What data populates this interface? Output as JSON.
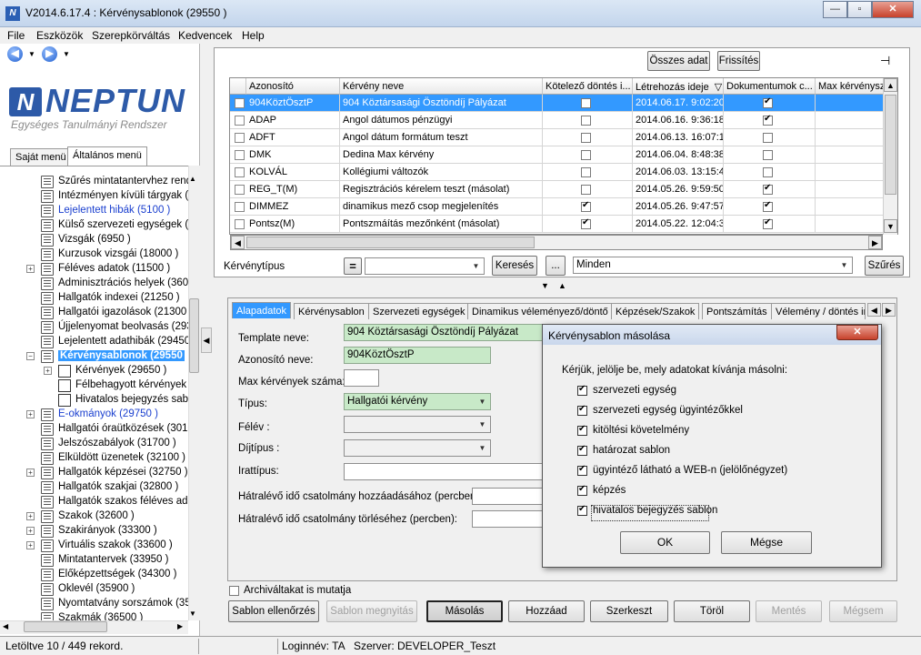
{
  "window": {
    "title": "V2014.6.17.4 : Kérvénysablonok (29550 )",
    "icon_letter": "N"
  },
  "menu": [
    "File",
    "Eszközök",
    "Szerepkörváltás",
    "Kedvencek",
    "Help"
  ],
  "logo": {
    "name": "NEPTUN",
    "subtitle": "Egységes Tanulmányi Rendszer"
  },
  "left_tabs": [
    "Saját menü",
    "Általános menü"
  ],
  "tree": [
    {
      "label": "Szűrés mintatantervhez rende",
      "level": 0,
      "expander": "",
      "icon": "folder",
      "style": ""
    },
    {
      "label": "Intézményen kívüli tárgyak (4",
      "level": 0,
      "expander": "",
      "icon": "folder",
      "style": ""
    },
    {
      "label": "Lejelentett hibák (5100 )",
      "level": 0,
      "expander": "",
      "icon": "folder",
      "style": "blue"
    },
    {
      "label": "Külső szervezeti egységek (6",
      "level": 0,
      "expander": "",
      "icon": "folder",
      "style": ""
    },
    {
      "label": "Vizsgák (6950 )",
      "level": 0,
      "expander": "",
      "icon": "folder",
      "style": ""
    },
    {
      "label": "Kurzusok vizsgái (18000 )",
      "level": 0,
      "expander": "",
      "icon": "folder",
      "style": ""
    },
    {
      "label": "Féléves adatok (11500 )",
      "level": 0,
      "expander": "+",
      "icon": "folder",
      "style": ""
    },
    {
      "label": "Adminisztrációs helyek (3600",
      "level": 0,
      "expander": "",
      "icon": "folder",
      "style": ""
    },
    {
      "label": "Hallgatók indexei (21250 )",
      "level": 0,
      "expander": "",
      "icon": "folder",
      "style": ""
    },
    {
      "label": "Hallgatói igazolások (21300 )",
      "level": 0,
      "expander": "",
      "icon": "folder",
      "style": ""
    },
    {
      "label": "Újjelenyomat beolvasás (29300",
      "level": 0,
      "expander": "",
      "icon": "folder",
      "style": ""
    },
    {
      "label": "Lejelentett adathibák (29450",
      "level": 0,
      "expander": "",
      "icon": "folder",
      "style": ""
    },
    {
      "label": "Kérvénysablonok (29550",
      "level": 0,
      "expander": "−",
      "icon": "folder",
      "style": "selected"
    },
    {
      "label": "Kérvények (29650 )",
      "level": 1,
      "expander": "+",
      "icon": "doc",
      "style": ""
    },
    {
      "label": "Félbehagyott kérvények (",
      "level": 1,
      "expander": "",
      "icon": "doc",
      "style": ""
    },
    {
      "label": "Hivatalos bejegyzés sablo",
      "level": 1,
      "expander": "",
      "icon": "doc",
      "style": ""
    },
    {
      "label": "E-okmányok (29750 )",
      "level": 0,
      "expander": "+",
      "icon": "folder",
      "style": "blue"
    },
    {
      "label": "Hallgatói óraütközések (3010",
      "level": 0,
      "expander": "",
      "icon": "folder",
      "style": ""
    },
    {
      "label": "Jelszószabályok (31700 )",
      "level": 0,
      "expander": "",
      "icon": "folder",
      "style": ""
    },
    {
      "label": "Elküldött üzenetek (32100 )",
      "level": 0,
      "expander": "",
      "icon": "folder",
      "style": ""
    },
    {
      "label": "Hallgatók képzései (32750 )",
      "level": 0,
      "expander": "+",
      "icon": "folder",
      "style": ""
    },
    {
      "label": "Hallgatók szakjai (32800 )",
      "level": 0,
      "expander": "",
      "icon": "folder",
      "style": ""
    },
    {
      "label": "Hallgatók szakos féléves ada",
      "level": 0,
      "expander": "",
      "icon": "folder",
      "style": ""
    },
    {
      "label": "Szakok (32600 )",
      "level": 0,
      "expander": "+",
      "icon": "folder",
      "style": ""
    },
    {
      "label": "Szakirányok (33300 )",
      "level": 0,
      "expander": "+",
      "icon": "folder",
      "style": ""
    },
    {
      "label": "Virtuális szakok (33600 )",
      "level": 0,
      "expander": "+",
      "icon": "folder",
      "style": ""
    },
    {
      "label": "Mintatantervek (33950 )",
      "level": 0,
      "expander": "",
      "icon": "folder",
      "style": ""
    },
    {
      "label": "Előképzettségek (34300 )",
      "level": 0,
      "expander": "",
      "icon": "folder",
      "style": ""
    },
    {
      "label": "Oklevél (35900 )",
      "level": 0,
      "expander": "",
      "icon": "folder",
      "style": ""
    },
    {
      "label": "Nyomtatvány sorszámok (359",
      "level": 0,
      "expander": "",
      "icon": "folder",
      "style": ""
    },
    {
      "label": "Szakmák (36500 )",
      "level": 0,
      "expander": "",
      "icon": "folder",
      "style": ""
    }
  ],
  "top_buttons": {
    "osszes_adat": "Összes adat",
    "frissites": "Frissítés"
  },
  "grid": {
    "columns": [
      "Azonosító",
      "Kérvény neve",
      "Kötelező döntés i...",
      "Létrehozás ideje",
      "Dokumentumok c...",
      "Max kérvénysz"
    ],
    "sort_indicator": "▽",
    "rows": [
      {
        "id": "904KöztÖsztP",
        "name": "904 Köztársasági Ösztöndíj Pályázat",
        "kotelezo": false,
        "letrehozas": "2014.06.17. 9:02:20",
        "dokumentumok": true,
        "selected": true
      },
      {
        "id": "ADAP",
        "name": "Angol dátumos pénzügyi",
        "kotelezo": false,
        "letrehozas": "2014.06.16. 9:36:18",
        "dokumentumok": true,
        "selected": false
      },
      {
        "id": "ADFT",
        "name": "Angol dátum formátum teszt",
        "kotelezo": false,
        "letrehozas": "2014.06.13. 16:07:1",
        "dokumentumok": false,
        "selected": false
      },
      {
        "id": "DMK",
        "name": "Dedina Max kérvény",
        "kotelezo": false,
        "letrehozas": "2014.06.04. 8:48:38",
        "dokumentumok": false,
        "selected": false
      },
      {
        "id": "KOLVÁL",
        "name": "Kollégiumi változók",
        "kotelezo": false,
        "letrehozas": "2014.06.03. 13:15:4",
        "dokumentumok": false,
        "selected": false
      },
      {
        "id": "REG_T(M)",
        "name": "Regisztrációs kérelem teszt (másolat)",
        "kotelezo": false,
        "letrehozas": "2014.05.26. 9:59:50",
        "dokumentumok": true,
        "selected": false
      },
      {
        "id": "DIMMEZ",
        "name": "dinamikus mező csop megjelenítés",
        "kotelezo": true,
        "letrehozas": "2014.05.26. 9:47:57",
        "dokumentumok": true,
        "selected": false
      },
      {
        "id": "Pontsz(M)",
        "name": "Pontszmáítás mezőnként (másolat)",
        "kotelezo": true,
        "letrehozas": "2014.05.22. 12:04:3",
        "dokumentumok": true,
        "selected": false
      }
    ]
  },
  "filter": {
    "label": "Kérvénytípus",
    "eq_symbol": "=",
    "search_button": "Keresés",
    "dots_button": "...",
    "value": "Minden",
    "filter_button": "Szűrés"
  },
  "detail_tabs": [
    "Alapadatok",
    "Kérvénysablon",
    "Szervezeti egységek",
    "Dinamikus véleményező/döntő",
    "Képzések/Szakok",
    "Pontszámítás",
    "Vélemény / döntés in"
  ],
  "form": {
    "template_nev": {
      "label": "Template neve:",
      "value": "904 Köztársasági Ösztöndíj Pályázat"
    },
    "azonosito": {
      "label": "Azonosító neve:",
      "value": "904KöztÖsztP"
    },
    "max_kervenyek": {
      "label": "Max kérvények száma:",
      "value": ""
    },
    "tipus": {
      "label": "Típus:",
      "value": "Hallgatói kérvény"
    },
    "felev": {
      "label": "Félév :",
      "value": ""
    },
    "dijtipus": {
      "label": "Díjtípus :",
      "value": ""
    },
    "irattipus": {
      "label": "Irattípus:",
      "value": ""
    },
    "hatralevo_hozzaadas": {
      "label": "Hátralévő idő csatolmány hozzáadásához (percben):",
      "value": ""
    },
    "hatralevo_torles": {
      "label": "Hátralévő idő csatolmány törléséhez (percben):",
      "value": ""
    },
    "archival": {
      "label": "Archiváltakat is mutatja",
      "checked": false
    }
  },
  "bottom_buttons": {
    "sablon_ellenorzes": "Sablon ellenőrzés",
    "sablon_megnyitas": "Sablon megnyitás",
    "masolas": "Másolás",
    "hozzaad": "Hozzáad",
    "szerkeszt": "Szerkeszt",
    "torol": "Töröl",
    "mentes": "Mentés",
    "megsem": "Mégsem"
  },
  "modal": {
    "title": "Kérvénysablon másolása",
    "close": "✕",
    "prompt": "Kérjük, jelölje be, mely adatokat kívánja másolni:",
    "options": [
      {
        "label": "szervezeti egység",
        "checked": true
      },
      {
        "label": "szervezeti egység ügyintézőkkel",
        "checked": true
      },
      {
        "label": "kitöltési követelmény",
        "checked": true
      },
      {
        "label": "határozat sablon",
        "checked": true
      },
      {
        "label": "ügyintéző látható a WEB-n (jelölőnégyzet)",
        "checked": true
      },
      {
        "label": "képzés",
        "checked": true
      },
      {
        "label": "hivatalos bejegyzés sablon",
        "checked": true
      }
    ],
    "ok": "OK",
    "cancel": "Mégse"
  },
  "status": {
    "records": "Letöltve 10 / 449 rekord.",
    "login": "Loginnév: TA",
    "server": "Szerver: DEVELOPER_Teszt"
  }
}
